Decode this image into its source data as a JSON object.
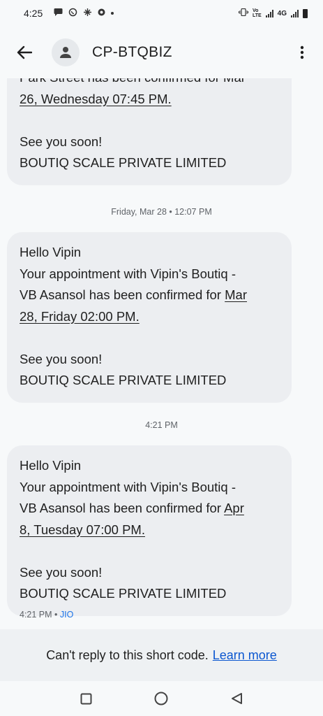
{
  "status_bar": {
    "time": "4:25",
    "network_label": "4G"
  },
  "header": {
    "title": "CP-BTQBIZ"
  },
  "messages": [
    {
      "partial_top": "Park Street has been confirmed for Mar",
      "date_line": "26, Wednesday 07:45 PM.",
      "signoff": "See you soon!",
      "company": "BOUTIQ SCALE PRIVATE LIMITED"
    },
    {
      "separator": "Friday, Mar 28 • 12:07 PM",
      "greeting": "Hello Vipin",
      "line1": "Your appointment with Vipin's Boutiq -",
      "line2_pre": "VB Asansol has been confirmed for ",
      "line2_link": "Mar",
      "date_line": "28, Friday 02:00 PM.",
      "signoff": "See you soon!",
      "company": "BOUTIQ SCALE PRIVATE LIMITED"
    },
    {
      "separator": "4:21 PM",
      "greeting": "Hello Vipin",
      "line1": "Your appointment with Vipin's Boutiq -",
      "line2_pre": "VB Asansol has been confirmed for ",
      "line2_link": "Apr",
      "date_line": "8, Tuesday 07:00 PM.",
      "signoff": "See you soon!",
      "company": "BOUTIQ SCALE PRIVATE LIMITED",
      "meta_time": "4:21 PM",
      "meta_sep": " • ",
      "meta_carrier": "JIO"
    }
  ],
  "reply_bar": {
    "text": "Can't reply to this short code.",
    "link": "Learn more"
  },
  "colors": {
    "background": "#f7f9fa",
    "bubble": "#eceef1",
    "link": "#0b57d0",
    "carrier": "#1a73e8"
  }
}
